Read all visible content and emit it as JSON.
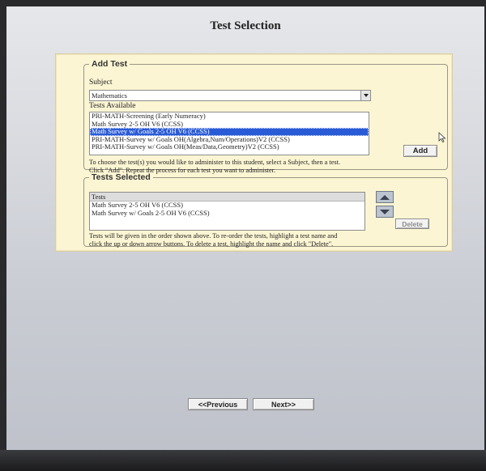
{
  "page": {
    "title": "Test Selection"
  },
  "add_test": {
    "legend": "Add Test",
    "subject_label": "Subject",
    "subject_value": "Mathematics",
    "tests_available_label": "Tests Available",
    "tests_available": [
      "PRI-MATH-Screening (Early Numeracy)",
      "Math Survey 2-5 OH V6 (CCSS)",
      "Math Survey w/ Goals 2-5 OH V6 (CCSS)",
      "PRI-MATH-Survey w/ Goals OH(Algebra,Num/Operations)V2 (CCSS)",
      "PRI-MATH-Survey w/ Goals OH(Meas/Data,Geometry)V2 (CCSS)"
    ],
    "selected_index": 2,
    "add_label": "Add",
    "instructions_line1": "To choose the test(s) you would like to administer to this student, select a Subject, then a test.",
    "instructions_line2": "Click \"Add\".  Repeat the process for each test you want to administer."
  },
  "tests_selected": {
    "legend": "Tests Selected",
    "column_header": "Tests",
    "items": [
      "Math Survey 2-5 OH V6 (CCSS)",
      "Math Survey w/ Goals 2-5 OH V6 (CCSS)"
    ],
    "delete_label": "Delete",
    "instructions_line1": "Tests will be given in the order shown above.  To re-order the tests, highlight a test name and",
    "instructions_line2": "click the up or down arrow buttons.  To delete a test, highlight the name and click \"Delete\"."
  },
  "nav": {
    "previous_label": "<<Previous",
    "next_label": "Next>>"
  },
  "icons": {
    "dropdown": "chevron-down-icon",
    "move_up": "arrow-up-icon",
    "move_down": "arrow-down-icon",
    "cursor": "mouse-pointer-icon"
  },
  "colors": {
    "panel_bg": "#fbf5d3",
    "selection": "#2a5bd6"
  }
}
